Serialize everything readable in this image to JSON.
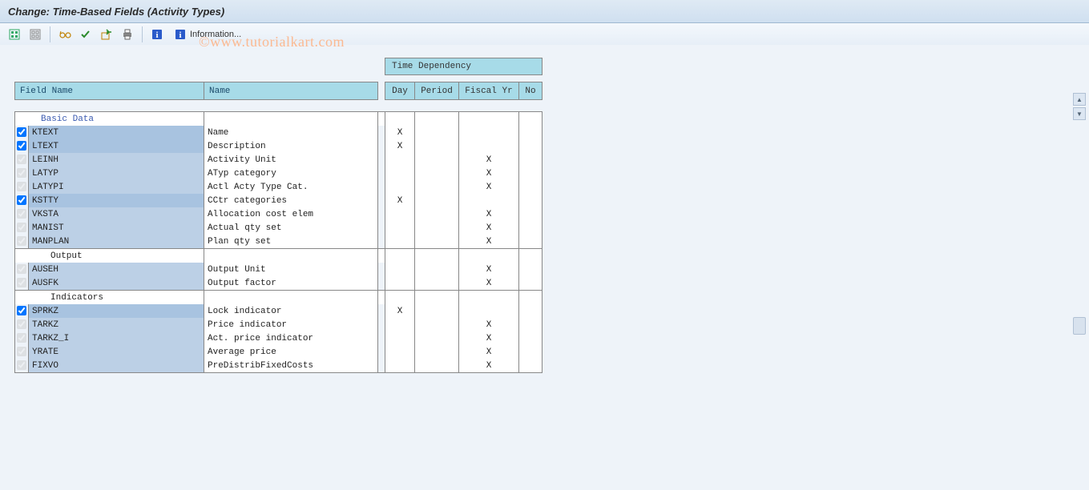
{
  "title": "Change: Time-Based Fields (Activity Types)",
  "toolbar": {
    "info_label": "Information..."
  },
  "watermark": "©www.tutorialkart.com",
  "headers": {
    "time_dependency": "Time Dependency",
    "field_name": "Field Name",
    "name": "Name",
    "day": "Day",
    "period": "Period",
    "fiscal_yr": "Fiscal Yr",
    "no": "No"
  },
  "groups": [
    {
      "label": "Basic Data",
      "is_section": true,
      "rows": [
        {
          "field": "KTEXT",
          "name": "Name",
          "enabled": true,
          "day": "X",
          "period": "",
          "fy": "",
          "no": ""
        },
        {
          "field": "LTEXT",
          "name": "Description",
          "enabled": true,
          "day": "X",
          "period": "",
          "fy": "",
          "no": ""
        },
        {
          "field": "LEINH",
          "name": "Activity Unit",
          "enabled": false,
          "day": "",
          "period": "",
          "fy": "X",
          "no": ""
        },
        {
          "field": "LATYP",
          "name": "ATyp category",
          "enabled": false,
          "day": "",
          "period": "",
          "fy": "X",
          "no": ""
        },
        {
          "field": "LATYPI",
          "name": "Actl Acty Type Cat.",
          "enabled": false,
          "day": "",
          "period": "",
          "fy": "X",
          "no": ""
        },
        {
          "field": "KSTTY",
          "name": "CCtr categories",
          "enabled": true,
          "day": "X",
          "period": "",
          "fy": "",
          "no": ""
        },
        {
          "field": "VKSTA",
          "name": "Allocation cost elem",
          "enabled": false,
          "day": "",
          "period": "",
          "fy": "X",
          "no": ""
        },
        {
          "field": "MANIST",
          "name": "Actual qty set",
          "enabled": false,
          "day": "",
          "period": "",
          "fy": "X",
          "no": ""
        },
        {
          "field": "MANPLAN",
          "name": "Plan qty set",
          "enabled": false,
          "day": "",
          "period": "",
          "fy": "X",
          "no": ""
        }
      ]
    },
    {
      "label": "Output",
      "is_section": false,
      "rows": [
        {
          "field": "AUSEH",
          "name": "Output Unit",
          "enabled": false,
          "day": "",
          "period": "",
          "fy": "X",
          "no": ""
        },
        {
          "field": "AUSFK",
          "name": "Output factor",
          "enabled": false,
          "day": "",
          "period": "",
          "fy": "X",
          "no": ""
        }
      ]
    },
    {
      "label": "Indicators",
      "is_section": false,
      "rows": [
        {
          "field": "SPRKZ",
          "name": "Lock indicator",
          "enabled": true,
          "day": "X",
          "period": "",
          "fy": "",
          "no": ""
        },
        {
          "field": "TARKZ",
          "name": "Price indicator",
          "enabled": false,
          "day": "",
          "period": "",
          "fy": "X",
          "no": ""
        },
        {
          "field": "TARKZ_I",
          "name": "Act. price indicator",
          "enabled": false,
          "day": "",
          "period": "",
          "fy": "X",
          "no": ""
        },
        {
          "field": "YRATE",
          "name": "Average price",
          "enabled": false,
          "day": "",
          "period": "",
          "fy": "X",
          "no": ""
        },
        {
          "field": "FIXVO",
          "name": "PreDistribFixedCosts",
          "enabled": false,
          "day": "",
          "period": "",
          "fy": "X",
          "no": ""
        }
      ]
    }
  ]
}
